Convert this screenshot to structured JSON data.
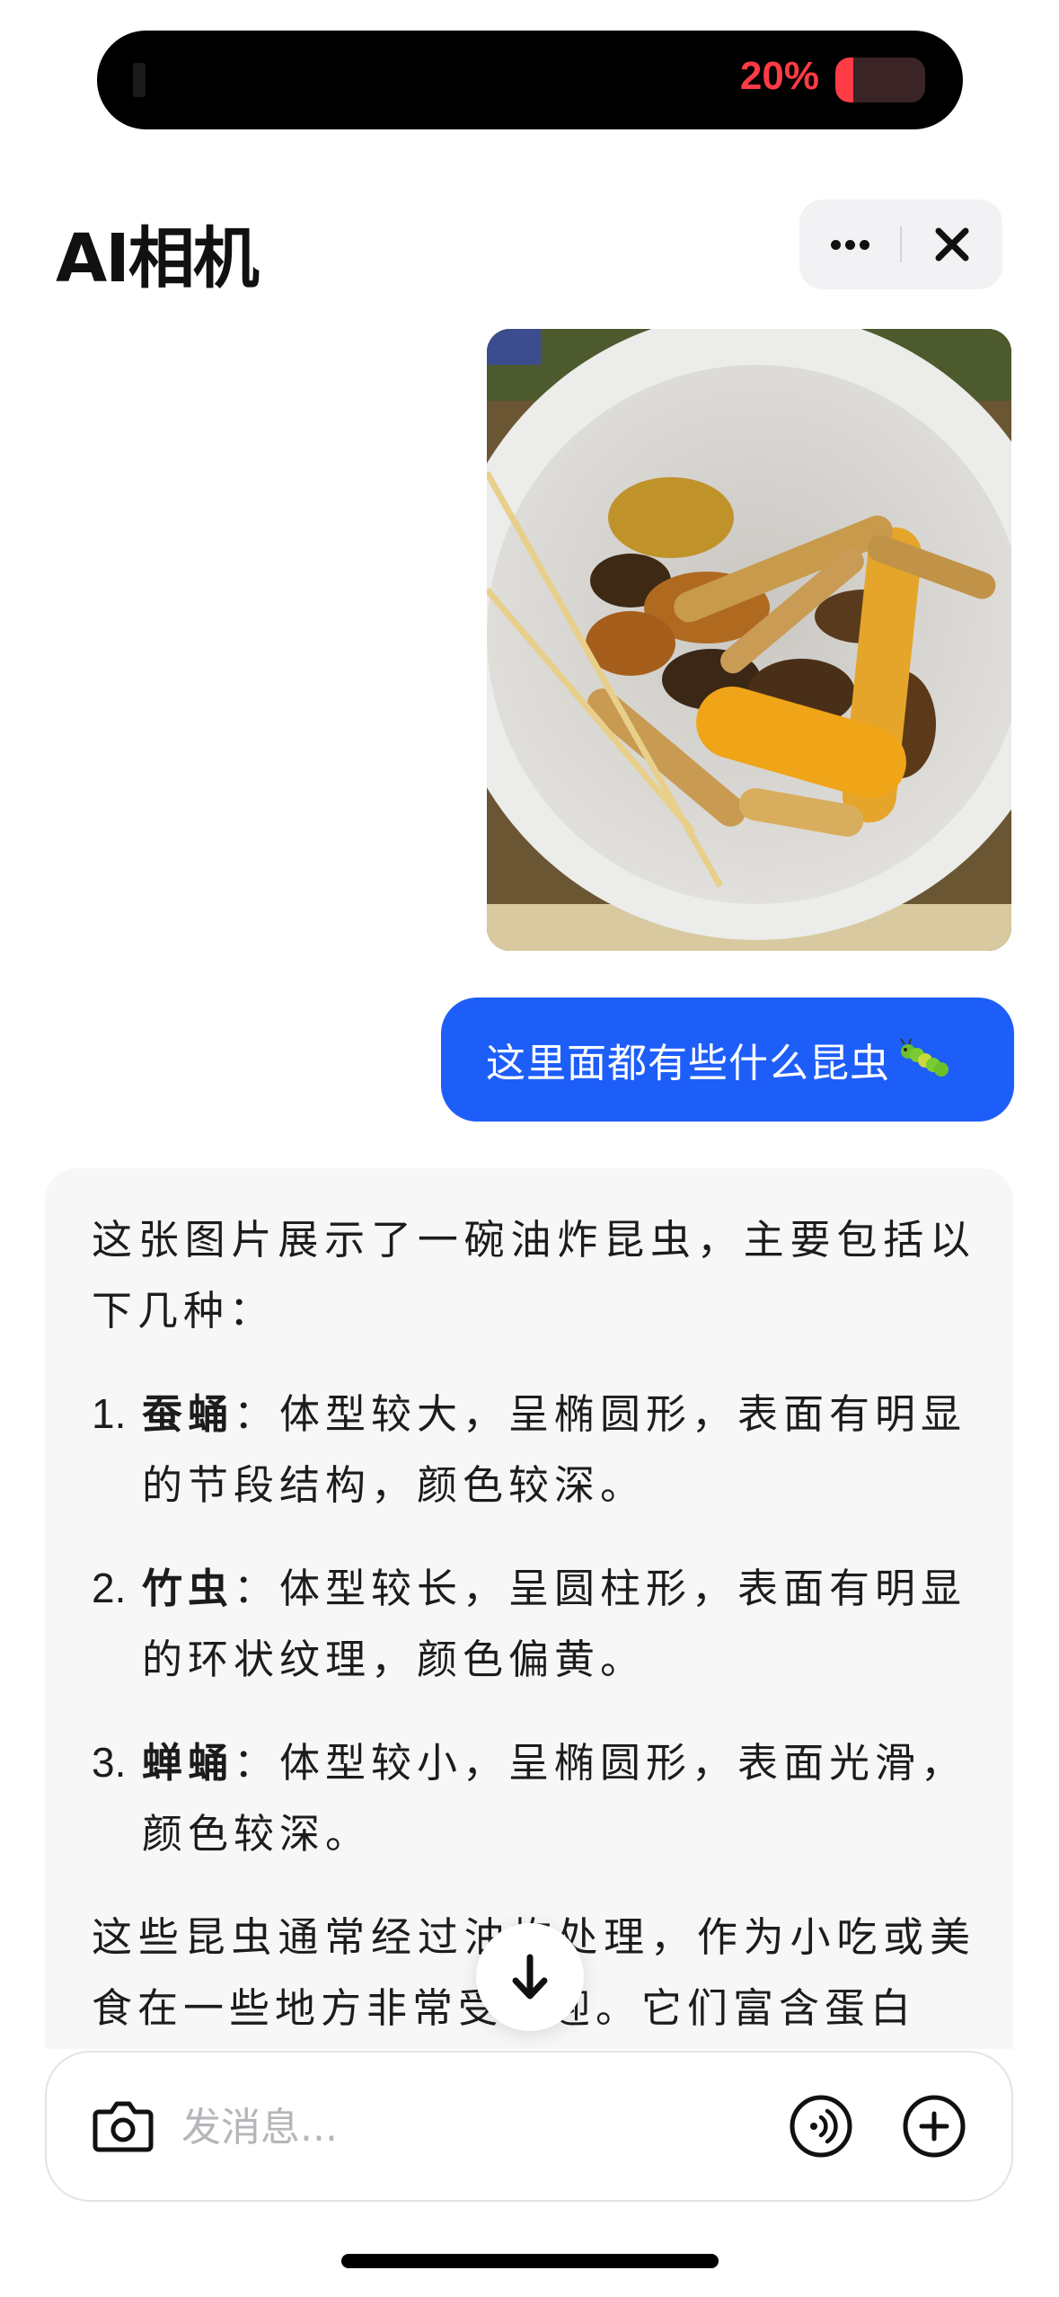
{
  "status_bar": {
    "battery_percent": "20%",
    "battery_level": 0.2,
    "battery_color": "#ff3b45"
  },
  "header": {
    "title": "AI相机",
    "more_icon": "more-horizontal-icon",
    "close_icon": "close-icon"
  },
  "conversation": {
    "user_image": {
      "icon": "photo-fried-insects-bowl"
    },
    "user_message": {
      "text": "这里面都有些什么昆虫",
      "emoji": "caterpillar-icon"
    },
    "ai_response": {
      "intro": "这张图片展示了一碗油炸昆虫，主要包括以下几种：",
      "items": [
        {
          "number": "1.",
          "term": "蚕蛹",
          "description": "：体型较大，呈椭圆形，表面有明显的节段结构，颜色较深。"
        },
        {
          "number": "2.",
          "term": "竹虫",
          "description": "：体型较长，呈圆柱形，表面有明显的环状纹理，颜色偏黄。"
        },
        {
          "number": "3.",
          "term": "蝉蛹",
          "description": "：体型较小，呈椭圆形，表面光滑，颜色较深。"
        }
      ],
      "outro": "这些昆虫通常经过油炸处理，作为小吃或美食在一些地方非常受欢迎。它们富含蛋白"
    }
  },
  "scroll_button_icon": "arrow-down-icon",
  "input": {
    "placeholder": "发消息...",
    "value": "",
    "camera_icon": "camera-icon",
    "voice_icon": "voice-call-icon",
    "plus_icon": "plus-circle-icon"
  },
  "colors": {
    "accent": "#1e5ef8",
    "card_bg": "#f7f7f8",
    "placeholder": "#b5b5ba"
  }
}
